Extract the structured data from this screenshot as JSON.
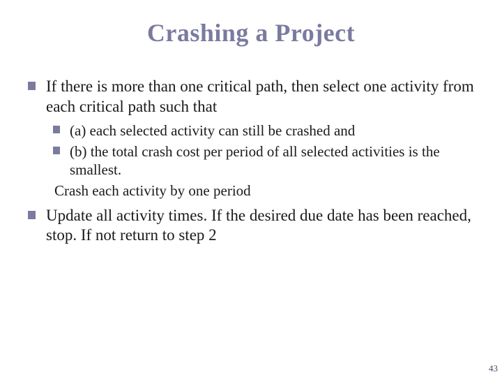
{
  "title": "Crashing a Project",
  "bullets": {
    "item1": "If there is more than one critical path, then select one activity from each critical path such that",
    "sub_a": "(a) each selected activity can still be crashed and",
    "sub_b": "(b) the total crash cost per period of all selected activities is the smallest.",
    "sub_tail": "Crash each activity by one period",
    "item2": "Update all activity times. If the desired due date has been reached, stop. If not return to step 2"
  },
  "page_number": "43"
}
